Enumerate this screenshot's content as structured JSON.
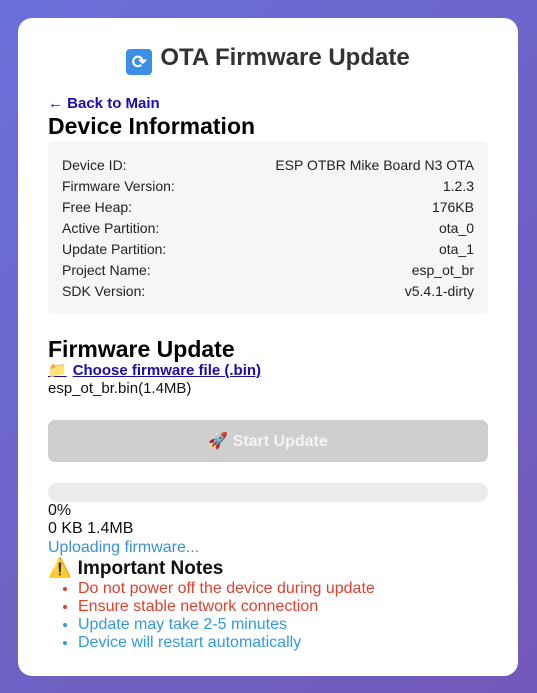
{
  "header": {
    "icon": "refresh-icon",
    "title": "OTA Firmware Update"
  },
  "nav": {
    "back_label": "← Back to Main"
  },
  "device_info": {
    "heading": "Device Information",
    "rows": [
      {
        "label": "Device ID:",
        "value": "ESP OTBR Mike Board N3 OTA"
      },
      {
        "label": "Firmware Version:",
        "value": "1.2.3"
      },
      {
        "label": "Free Heap:",
        "value": "176KB"
      },
      {
        "label": "Active Partition:",
        "value": "ota_0"
      },
      {
        "label": "Update Partition:",
        "value": "ota_1"
      },
      {
        "label": "Project Name:",
        "value": "esp_ot_br"
      },
      {
        "label": "SDK Version:",
        "value": "v5.4.1-dirty"
      }
    ]
  },
  "firmware": {
    "heading": "Firmware Update",
    "choose_label": "Choose firmware file (.bin)",
    "selected_file": "esp_ot_br.bin(1.4MB)",
    "start_label": "🚀 Start Update",
    "start_disabled": true,
    "progress_percent": 0,
    "progress_text": "0%",
    "bytes_text": "0 KB 1.4MB",
    "status_text": "Uploading firmware..."
  },
  "notes": {
    "heading": "Important Notes",
    "items": [
      {
        "text": "Do not power off the device during update",
        "color": "#e0402c"
      },
      {
        "text": "Ensure stable network connection",
        "color": "#e0402c"
      },
      {
        "text": "Update may take 2-5 minutes",
        "color": "#3399dd"
      },
      {
        "text": "Device will restart automatically",
        "color": "#3399dd"
      }
    ]
  },
  "colors": {
    "accent": "#3b8fe8",
    "link": "#1a0dab",
    "warning": "#e0402c",
    "info": "#3399dd"
  }
}
